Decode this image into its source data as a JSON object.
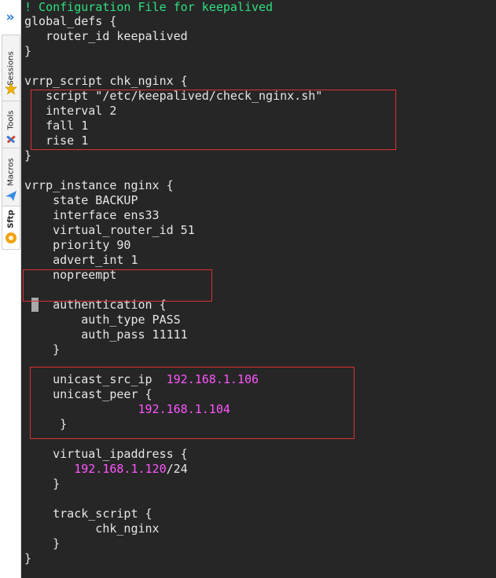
{
  "sidebar": {
    "expand_icon": "double-chevron-right-icon",
    "tabs": [
      {
        "label": "Sessions",
        "icon": "star-icon"
      },
      {
        "label": "Tools",
        "icon": "tools-icon"
      },
      {
        "label": "Macros",
        "icon": "paper-plane-icon"
      },
      {
        "label": "Sftp",
        "icon": "sftp-icon"
      }
    ],
    "active_tab": "Sftp"
  },
  "colors": {
    "terminal_bg": "#262626",
    "text": "#e6e6e6",
    "comment": "#2ee080",
    "ip_literal": "#ff55ff",
    "highlight_box": "#e03131"
  },
  "config": {
    "l1": "! Configuration File for keepalived",
    "l2": "global_defs {",
    "l3": "   router_id keepalived",
    "l4": "}",
    "l5": "vrrp_script chk_nginx {",
    "l6": "   script \"/etc/keepalived/check_nginx.sh\"",
    "l7": "   interval 2",
    "l8": "   fall 1",
    "l9": "   rise 1",
    "l10": "}",
    "l11": "vrrp_instance nginx {",
    "l12": "    state BACKUP",
    "l13": "    interface ens33",
    "l14": "    virtual_router_id 51",
    "l15": "    priority 90",
    "l16": "    advert_int 1",
    "l17": "    nopreempt",
    "l18": "    authentication {",
    "l19": "        auth_type PASS",
    "l20": "        auth_pass 11111",
    "l21": "    }",
    "l22a": "    unicast_src_ip  ",
    "l22b": "192.168.1.106",
    "l23": "    unicast_peer {",
    "l24a": "                ",
    "l24b": "192.168.1.104",
    "l25": "     }",
    "l26": "    virtual_ipaddress {",
    "l27a": "       ",
    "l27b": "192.168.1.120",
    "l27c": "/24",
    "l28": "    }",
    "l29": "    track_script {",
    "l30": "          chk_nginx",
    "l31": "    }",
    "l32": "}"
  }
}
